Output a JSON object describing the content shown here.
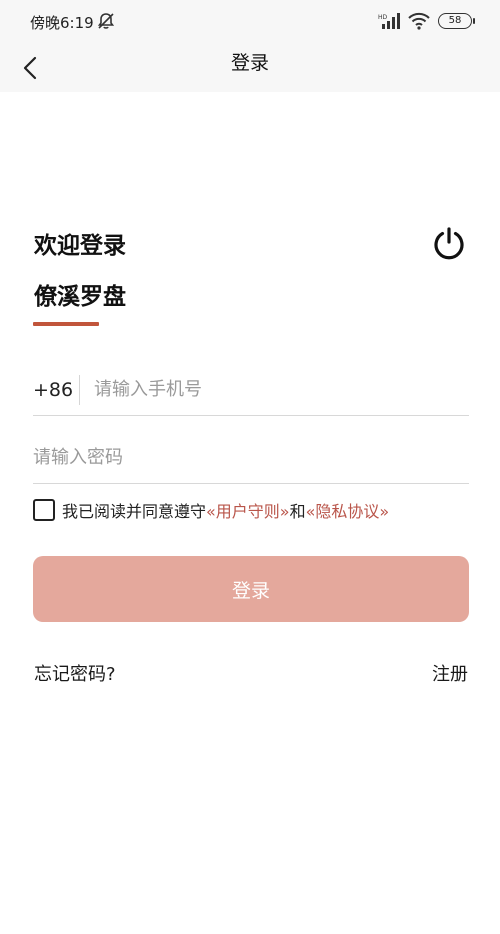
{
  "status_bar": {
    "time": "傍晚6:19",
    "battery": "58",
    "icons": [
      "mute-icon",
      "hd-signal-icon",
      "wifi-icon",
      "battery-icon"
    ]
  },
  "nav": {
    "title": "登录",
    "back_icon": "chevron-left-icon"
  },
  "welcome": {
    "title": "欢迎登录",
    "app_name": "僚溪罗盘",
    "accent_color": "#c1553b",
    "right_icon": "power-icon"
  },
  "phone": {
    "country_code": "+86",
    "placeholder": "请输入手机号",
    "value": ""
  },
  "password": {
    "placeholder": "请输入密码",
    "value": ""
  },
  "agreement": {
    "checked": false,
    "prefix": "我已阅读并同意遵守",
    "user_terms": "«用户守则»",
    "conjunction": "和",
    "privacy": "«隐私协议»",
    "link_color": "#b9554a"
  },
  "login_button": {
    "label": "登录",
    "color": "#e4a89c"
  },
  "links": {
    "forgot": "忘记密码?",
    "register": "注册"
  }
}
